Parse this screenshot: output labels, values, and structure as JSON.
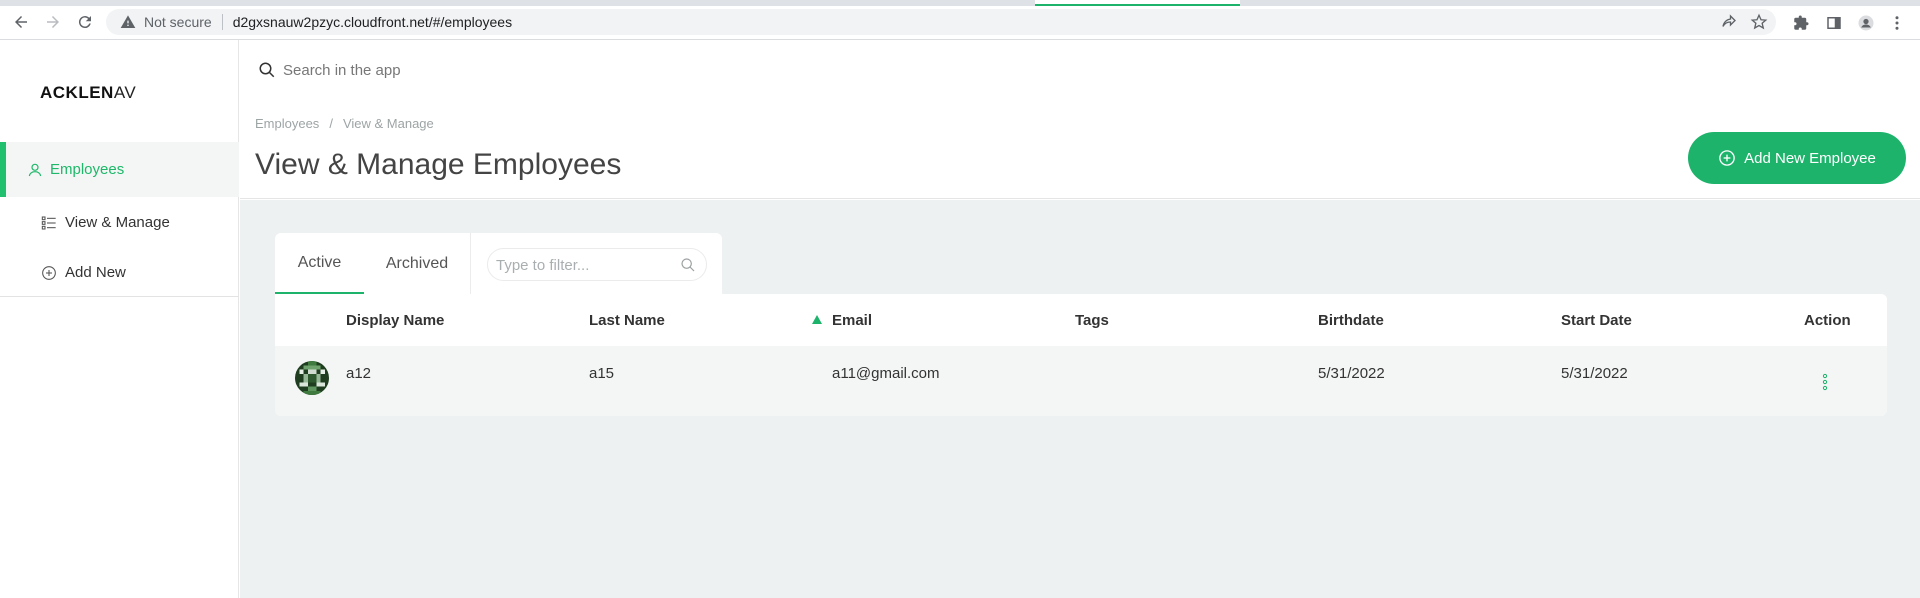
{
  "browser": {
    "security_label": "Not secure",
    "url": "d2gxsnauw2pzyc.cloudfront.net/#/employees"
  },
  "sidebar": {
    "logo_bold": "ACKLEN",
    "logo_light": "AV",
    "items": [
      {
        "label": "Employees",
        "icon": "user-icon",
        "active": true
      },
      {
        "label": "View & Manage",
        "icon": "list-icon"
      },
      {
        "label": "Add New",
        "icon": "plus-circle-icon"
      }
    ]
  },
  "search": {
    "placeholder": "Search in the app"
  },
  "breadcrumb": [
    "Employees",
    "/",
    "View & Manage"
  ],
  "page_title": "View & Manage Employees",
  "add_button_label": "Add New Employee",
  "tabs": [
    {
      "label": "Active",
      "selected": true
    },
    {
      "label": "Archived",
      "selected": false
    }
  ],
  "filter": {
    "placeholder": "Type to filter..."
  },
  "table": {
    "columns": [
      "Display Name",
      "Last Name",
      "Email",
      "Tags",
      "Birthdate",
      "Start Date",
      "Action"
    ],
    "sorted_column": "Email",
    "rows": [
      {
        "display_name": "a12",
        "last_name": "a15",
        "email": "a11@gmail.com",
        "tags": "",
        "birthdate": "5/31/2022",
        "start_date": "5/31/2022"
      }
    ]
  },
  "colors": {
    "accent": "#1db36b",
    "background": "#eef1f1"
  }
}
